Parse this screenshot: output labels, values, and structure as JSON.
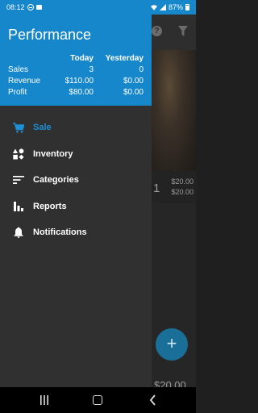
{
  "status_bar": {
    "time": "08:12",
    "battery": "87%"
  },
  "drawer": {
    "title": "Performance",
    "columns": {
      "today": "Today",
      "yesterday": "Yesterday"
    },
    "rows": [
      {
        "label": "Sales",
        "today": "3",
        "yesterday": "0"
      },
      {
        "label": "Revenue",
        "today": "$110.00",
        "yesterday": "$0.00"
      },
      {
        "label": "Profit",
        "today": "$80.00",
        "yesterday": "$0.00"
      }
    ],
    "menu": [
      {
        "label": "Sale",
        "icon": "cart-icon",
        "active": true
      },
      {
        "label": "Inventory",
        "icon": "shapes-icon",
        "active": false
      },
      {
        "label": "Categories",
        "icon": "sort-icon",
        "active": false
      },
      {
        "label": "Reports",
        "icon": "bar-chart-icon",
        "active": false
      },
      {
        "label": "Notifications",
        "icon": "bell-icon",
        "active": false
      }
    ]
  },
  "background_app": {
    "help_icon": "?",
    "quantity": "1",
    "price_1": "$20.00",
    "price_2": "$20.00",
    "fab_label": "+",
    "total": "$20.00"
  },
  "colors": {
    "accent": "#1787cc",
    "active_item": "#1d8fd6",
    "drawer_bg": "#303030"
  }
}
